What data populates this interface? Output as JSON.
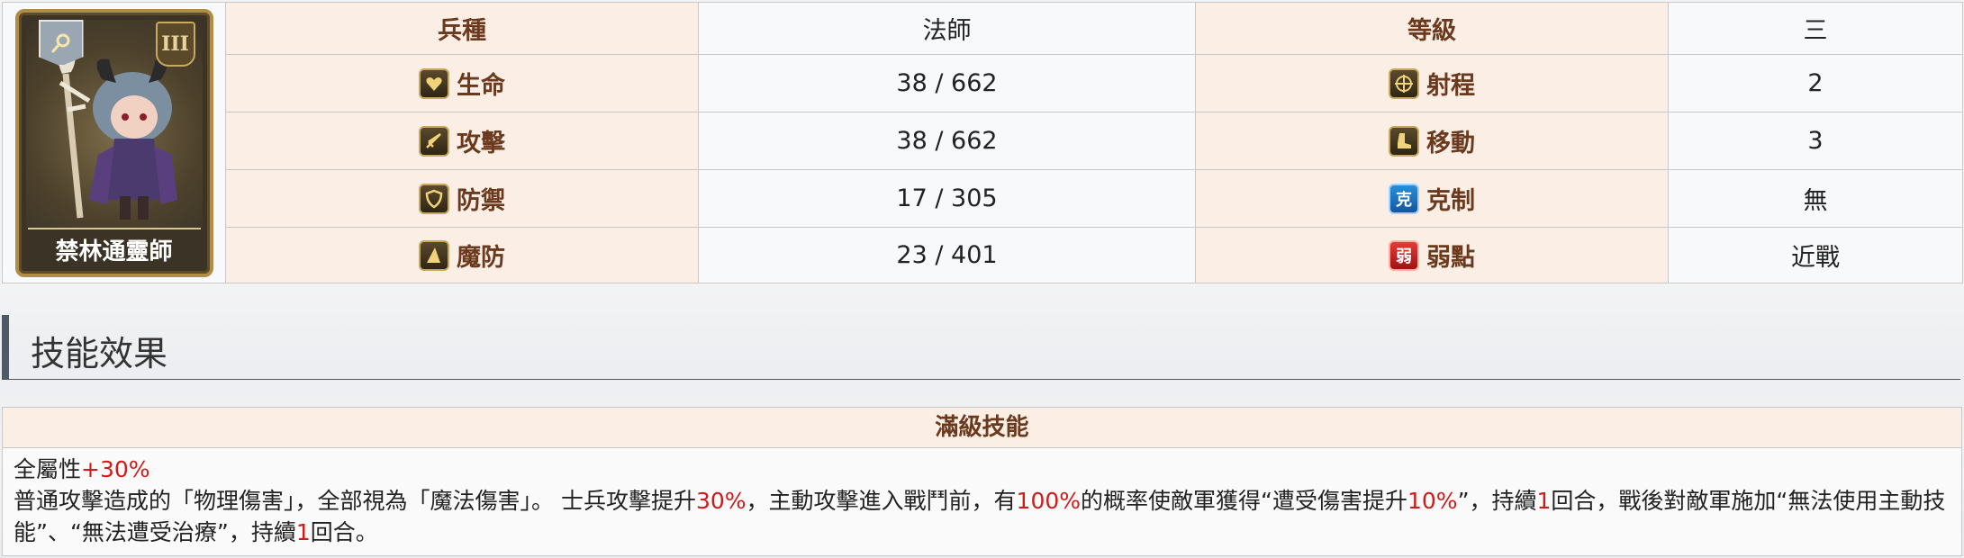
{
  "unit": {
    "name": "禁林通靈師",
    "rank_badge": "III"
  },
  "stats_table": {
    "rows": [
      {
        "l_label": "兵種",
        "l_value": "法師",
        "r_label": "等級",
        "r_value": "三"
      },
      {
        "l_label": "生命",
        "l_value": "38 / 662",
        "r_label": "射程",
        "r_value": "2"
      },
      {
        "l_label": "攻擊",
        "l_value": "38 / 662",
        "r_label": "移動",
        "r_value": "3"
      },
      {
        "l_label": "防禦",
        "l_value": "17 / 305",
        "r_label": "克制",
        "r_value": "無"
      },
      {
        "l_label": "魔防",
        "l_value": "23 / 401",
        "r_label": "弱點",
        "r_value": "近戰"
      }
    ],
    "icons": {
      "hp": "heart-icon",
      "atk": "sword-icon",
      "def": "shield-icon",
      "mdef": "magic-hat-icon",
      "range": "crosshair-icon",
      "move": "boot-icon",
      "counter": "counter-icon",
      "weak": "weakness-icon"
    },
    "icon_glyphs": {
      "counter": "克",
      "weak": "弱"
    }
  },
  "section": {
    "title": "技能效果"
  },
  "skill": {
    "header": "滿級技能",
    "line1": {
      "t1": "全屬性",
      "r1": "+30%"
    },
    "line2": {
      "t1": "普通攻擊造成的「物理傷害」，全部視為「魔法傷害」。 士兵攻擊提升",
      "r1": "30%",
      "t2": "，主動攻擊進入戰鬥前，有",
      "r2": "100%",
      "t3": "的概率使敵軍獲得“遭受傷害提升",
      "r3": "10%",
      "t4": "”，持續",
      "r4": "1",
      "t5": "回合，戰後對敵軍施加“無法使用主動技能”、“無法遭受治療”，持續",
      "r5": "1",
      "t6": "回合。"
    }
  },
  "colors": {
    "header_bg": "#fbeee4",
    "header_text": "#6b3a1e",
    "highlight": "#d11a1a"
  }
}
